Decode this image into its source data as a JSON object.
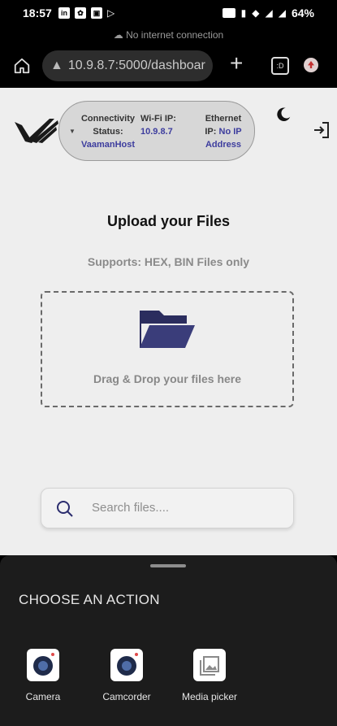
{
  "status_bar": {
    "time": "18:57",
    "battery": "64%"
  },
  "network_banner": {
    "text": "No internet connection"
  },
  "browser": {
    "url": "10.9.8.7:5000/dashboar",
    "tabs_label": ":D"
  },
  "header": {
    "connectivity_label": "Connectivity Status:",
    "host": "VaamanHost",
    "wifi_label": "Wi-Fi IP:",
    "wifi_ip": "10.9.8.7",
    "ethernet_label": "Ethernet IP:",
    "ethernet_ip": "No IP Address"
  },
  "upload": {
    "title": "Upload your Files",
    "supports": "Supports: HEX, BIN Files only",
    "drop_text": "Drag & Drop your files here"
  },
  "search": {
    "placeholder": "Search files...."
  },
  "action_sheet": {
    "title": "CHOOSE AN ACTION",
    "actions": [
      {
        "label": "Camera"
      },
      {
        "label": "Camcorder"
      },
      {
        "label": "Media picker"
      }
    ]
  },
  "colors": {
    "accent": "#3d3d9e",
    "sheet_bg": "#1c1c1c"
  }
}
